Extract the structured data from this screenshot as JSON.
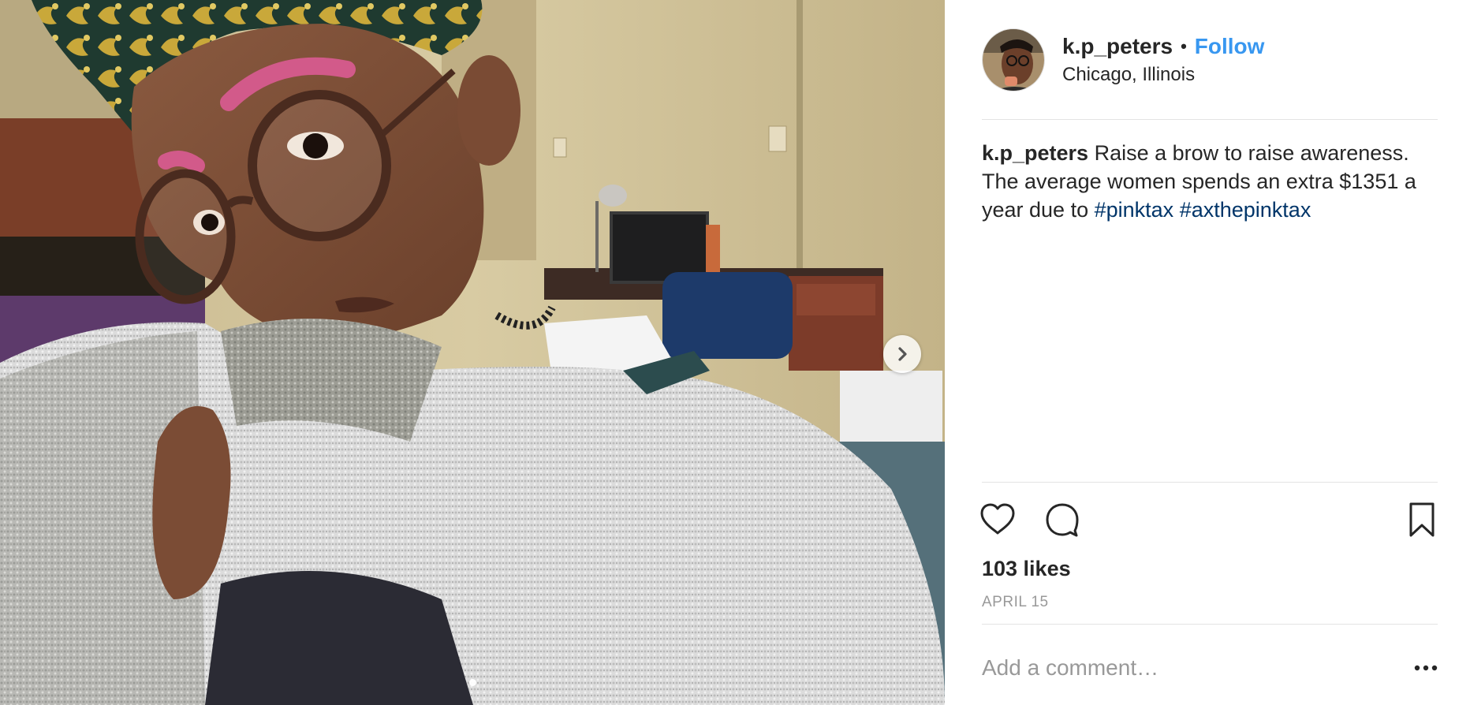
{
  "post": {
    "username": "k.p_peters",
    "separator": "•",
    "follow_label": "Follow",
    "location": "Chicago, Illinois",
    "caption": {
      "username": "k.p_peters",
      "text": "Raise a brow to raise awareness. The average women spends an extra $1351 a year due to",
      "hashtags": [
        "#pinktax",
        "#axthepinktax"
      ]
    },
    "likes": "103 likes",
    "date": "APRIL 15"
  },
  "media": {
    "description_icon": "selfie-photo",
    "next_icon": "chevron-right-icon",
    "carousel_count": 1,
    "carousel_active": 0
  },
  "actions": {
    "like_icon": "heart-icon",
    "comment_icon": "comment-bubble-icon",
    "save_icon": "bookmark-icon",
    "more_icon": "ellipsis-icon"
  },
  "comment": {
    "placeholder": "Add a comment…",
    "value": ""
  },
  "colors": {
    "link_blue": "#3897f0",
    "hashtag_blue": "#003569",
    "text": "#262626",
    "muted": "#999999",
    "divider": "#e3e3e3"
  }
}
